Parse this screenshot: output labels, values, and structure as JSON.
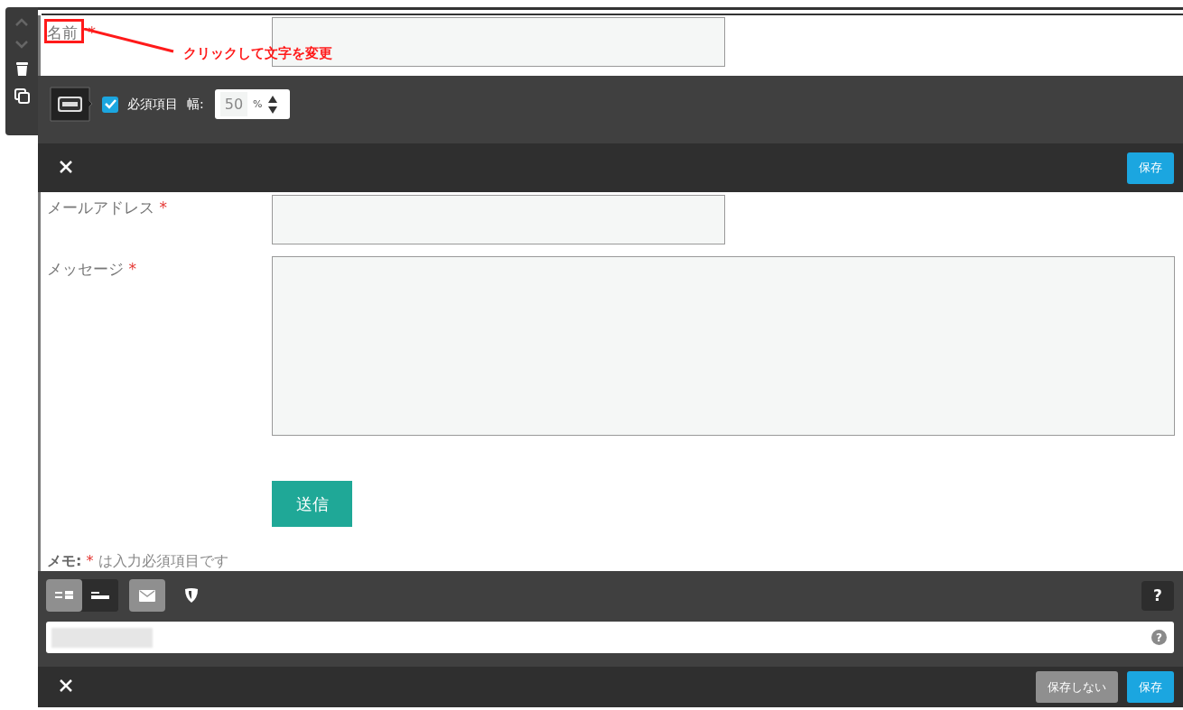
{
  "name_field": {
    "label": "名前",
    "required_mark": "*",
    "annotation": "クリックして文字を変更"
  },
  "settings": {
    "checkbox_label": "必須項目",
    "checked": true,
    "width_label": "幅:",
    "width_value": "50",
    "width_unit": "%"
  },
  "editor_bar": {
    "save": "保存"
  },
  "fields": [
    {
      "kind": "input",
      "label": "メールアドレス",
      "required_mark": "*"
    },
    {
      "kind": "textarea",
      "label": "メッセージ",
      "required_mark": "*"
    }
  ],
  "submit": "送信",
  "memo": {
    "label": "メモ:",
    "mark": "*",
    "text": "は入力必須項目です"
  },
  "layout_toggles": [
    {
      "kind": "two-column",
      "selected": true
    },
    {
      "kind": "one-column",
      "selected": false
    }
  ],
  "mail_toggle": {
    "on": true
  },
  "help": "?",
  "email_field": {
    "help": "?"
  },
  "footer": {
    "cancel": "保存しない",
    "save": "保存"
  }
}
